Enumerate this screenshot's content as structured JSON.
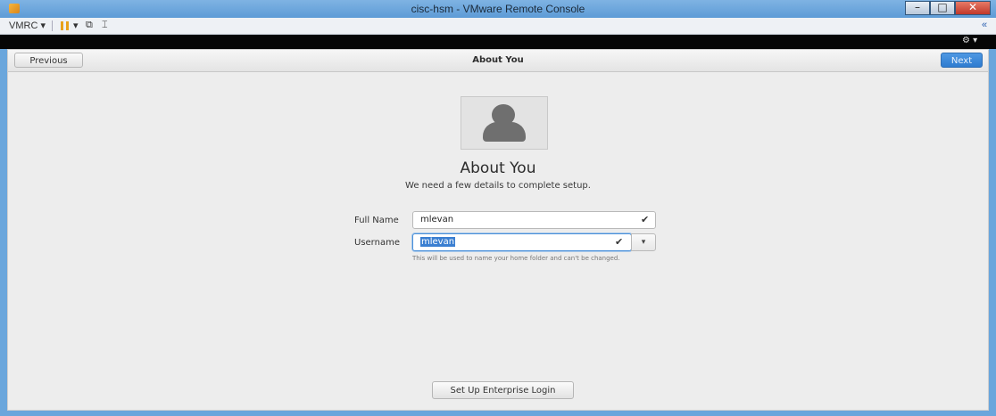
{
  "window": {
    "title": "cisc-hsm - VMware Remote Console",
    "controls": {
      "minimize": "–",
      "maximize": "□",
      "close": "✕"
    }
  },
  "toolbar": {
    "vmrc_menu": "VMRC ▾",
    "pause_dropdown": "▾",
    "send_keys_icon": "⧉",
    "fullscreen_icon": "⌶",
    "collapse_icon": "«"
  },
  "vm_topbar": {
    "accessibility_icon": "⚙ ▾"
  },
  "setup": {
    "header_title": "About You",
    "previous_label": "Previous",
    "next_label": "Next",
    "heading": "About You",
    "subheading": "We need a few details to complete setup.",
    "full_name_label": "Full Name",
    "full_name_value": "mlevan",
    "username_label": "Username",
    "username_value": "mlevan",
    "check_mark": "✔",
    "dropdown_arrow": "▾",
    "hint_text": "This will be used to name your home folder and can't be changed.",
    "enterprise_button": "Set Up Enterprise Login"
  }
}
